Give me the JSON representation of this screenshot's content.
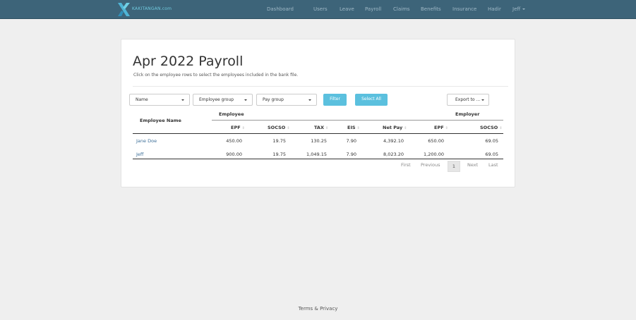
{
  "nav": {
    "brand": "KAKITANGAN.com",
    "items": [
      "Dashboard",
      "Users",
      "Leave",
      "Payroll",
      "Claims",
      "Benefits",
      "Insurance",
      "Hadir",
      "Jeff"
    ]
  },
  "page": {
    "title": "Apr 2022 Payroll",
    "subtitle": "Click on the employee rows to select the employees included in the bank file."
  },
  "filters": {
    "name": "Name",
    "employee_group": "Employee group",
    "pay_group": "Pay group",
    "filter_label": "Filter",
    "select_all_label": "Select All",
    "export_label": "Export to ..."
  },
  "table": {
    "name_header": "Employee Name",
    "group_employee": "Employee",
    "group_employer": "Employer",
    "columns": [
      "EPF",
      "SOCSO",
      "TAX",
      "EIS",
      "Net Pay",
      "EPF",
      "SOCSO"
    ],
    "rows": [
      {
        "name": "Jane Doe",
        "values": [
          "450.00",
          "19.75",
          "130.25",
          "7.90",
          "4,392.10",
          "650.00",
          "69.05"
        ]
      },
      {
        "name": "Jeff",
        "values": [
          "900.00",
          "19.75",
          "1,049.15",
          "7.90",
          "8,023.20",
          "1,200.00",
          "69.05"
        ]
      }
    ]
  },
  "pagination": {
    "first": "First",
    "previous": "Previous",
    "current": "1",
    "next": "Next",
    "last": "Last"
  },
  "footer": {
    "text": "Terms & Privacy"
  },
  "colors": {
    "navbar": "#3d6479",
    "accent": "#5bc0de",
    "link": "#3d6f99"
  }
}
